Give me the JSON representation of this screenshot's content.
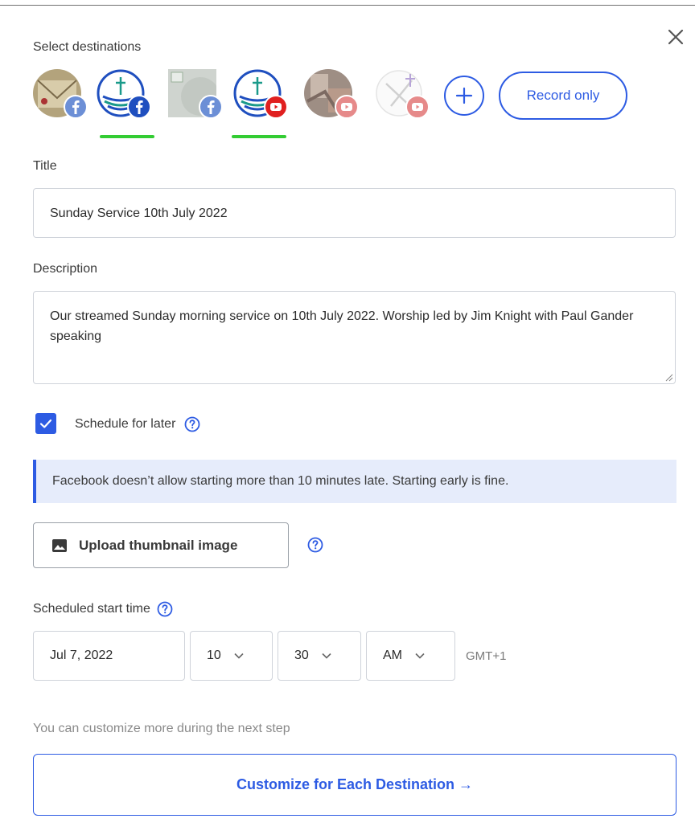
{
  "header": {
    "select_destinations_label": "Select destinations",
    "close_icon": "close-icon"
  },
  "destinations": [
    {
      "avatar": "photo-avatar",
      "platform": "facebook",
      "selected": false
    },
    {
      "avatar": "church-logo",
      "platform": "facebook",
      "selected": true
    },
    {
      "avatar": "placeholder-image",
      "platform": "facebook",
      "selected": false
    },
    {
      "avatar": "church-logo",
      "platform": "youtube",
      "selected": true
    },
    {
      "avatar": "photo-avatar",
      "platform": "youtube",
      "selected": false
    },
    {
      "avatar": "placeholder-logo",
      "platform": "youtube",
      "selected": false
    }
  ],
  "record_only_label": "Record only",
  "title": {
    "label": "Title",
    "value": "Sunday Service 10th July 2022"
  },
  "description": {
    "label": "Description",
    "value": "Our streamed Sunday morning service on 10th July 2022. Worship led by Jim Knight with Paul Gander speaking"
  },
  "schedule": {
    "checkbox_label": "Schedule for later",
    "checked": true
  },
  "info_banner": "Facebook doesn’t allow starting more than 10 minutes late. Starting early is fine.",
  "upload_thumbnail_label": "Upload thumbnail image",
  "scheduled_start": {
    "label": "Scheduled start time",
    "date": "Jul 7, 2022",
    "hour": "10",
    "minute": "30",
    "ampm": "AM",
    "timezone": "GMT+1"
  },
  "hint_text": "You can customize more during the next step",
  "customize_button_label": "Customize for Each Destination →",
  "colors": {
    "accent": "#2d5be3",
    "facebook": "#1877f2",
    "youtube": "#e02020",
    "selected_underline": "#33cc33",
    "banner_bg": "#e6ecfb"
  }
}
